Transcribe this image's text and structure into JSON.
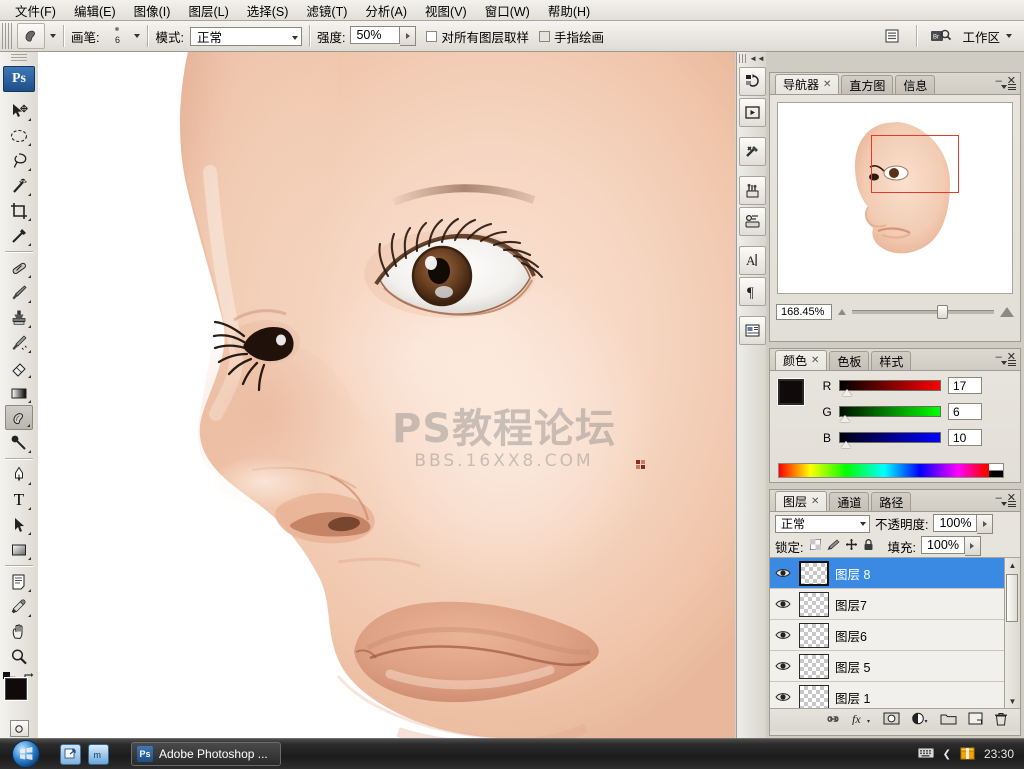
{
  "menubar": {
    "items": [
      {
        "label": "文件(F)"
      },
      {
        "label": "编辑(E)"
      },
      {
        "label": "图像(I)"
      },
      {
        "label": "图层(L)"
      },
      {
        "label": "选择(S)"
      },
      {
        "label": "滤镜(T)"
      },
      {
        "label": "分析(A)"
      },
      {
        "label": "视图(V)"
      },
      {
        "label": "窗口(W)"
      },
      {
        "label": "帮助(H)"
      }
    ]
  },
  "options_bar": {
    "tool_icon": "smudge-tool-icon",
    "brush_label": "画笔:",
    "brush_size": "6",
    "mode_label": "模式:",
    "mode_value": "正常",
    "strength_label": "强度:",
    "strength_value": "50%",
    "sample_all_layers": "对所有图层取样",
    "finger_painting": "手指绘画",
    "palette_toggle": "palette-toggle-icon",
    "bridge_icon": "bridge-icon",
    "workspace_label": "工作区"
  },
  "toolbox": {
    "logo": "Ps",
    "tools": [
      {
        "name": "move-tool",
        "glyph": "move"
      },
      {
        "name": "marquee-tool",
        "glyph": "ellipse"
      },
      {
        "name": "lasso-tool",
        "glyph": "lasso"
      },
      {
        "name": "magic-wand-tool",
        "glyph": "wand"
      },
      {
        "name": "crop-tool",
        "glyph": "crop"
      },
      {
        "name": "slice-tool",
        "glyph": "slice"
      },
      {
        "name": "healing-brush-tool",
        "glyph": "bandage"
      },
      {
        "name": "brush-tool",
        "glyph": "brush"
      },
      {
        "name": "clone-stamp-tool",
        "glyph": "stamp"
      },
      {
        "name": "history-brush-tool",
        "glyph": "historybrush"
      },
      {
        "name": "eraser-tool",
        "glyph": "eraser"
      },
      {
        "name": "gradient-tool",
        "glyph": "gradient"
      },
      {
        "name": "smudge-tool",
        "glyph": "smudge",
        "selected": true
      },
      {
        "name": "dodge-tool",
        "glyph": "dodge"
      },
      {
        "name": "pen-tool",
        "glyph": "pen"
      },
      {
        "name": "type-tool",
        "glyph": "T"
      },
      {
        "name": "path-selection-tool",
        "glyph": "arrow"
      },
      {
        "name": "shape-tool",
        "glyph": "rect"
      },
      {
        "name": "notes-tool",
        "glyph": "note"
      },
      {
        "name": "eyedropper-tool",
        "glyph": "dropper"
      },
      {
        "name": "hand-tool",
        "glyph": "hand"
      },
      {
        "name": "zoom-tool",
        "glyph": "magnifier"
      }
    ],
    "foreground_color": "#110a0a",
    "background_color": "#e8b79a",
    "default_colors_label": "default-colors",
    "swap_colors_label": "swap-colors"
  },
  "canvas": {
    "watermark_line1": "PS教程论坛",
    "watermark_line2": "BBS.16XX8.COM",
    "artwork": "digital-painted-face"
  },
  "icon_dock": {
    "items": [
      {
        "name": "history-panel-icon"
      },
      {
        "name": "actions-panel-icon"
      },
      {
        "name": "tool-presets-icon"
      },
      {
        "name": "brushes-panel-icon"
      },
      {
        "name": "clone-source-icon"
      },
      {
        "name": "character-panel-icon"
      },
      {
        "name": "paragraph-panel-icon"
      },
      {
        "name": "layer-comps-icon"
      }
    ]
  },
  "navigator_panel": {
    "tabs": [
      {
        "label": "导航器",
        "active": true,
        "closable": true
      },
      {
        "label": "直方图",
        "active": false
      },
      {
        "label": "信息",
        "active": false
      }
    ],
    "zoom_value": "168.45%"
  },
  "color_panel": {
    "tabs": [
      {
        "label": "颜色",
        "active": true,
        "closable": true
      },
      {
        "label": "色板",
        "active": false
      },
      {
        "label": "样式",
        "active": false
      }
    ],
    "channels": [
      {
        "label": "R",
        "value": "17",
        "pct": 6.7
      },
      {
        "label": "G",
        "value": "6",
        "pct": 2.4
      },
      {
        "label": "B",
        "value": "10",
        "pct": 3.9
      }
    ],
    "foreground_color": "#110a0a",
    "background_color": "#e8b79a"
  },
  "layers_panel": {
    "tabs": [
      {
        "label": "图层",
        "active": true,
        "closable": true
      },
      {
        "label": "通道",
        "active": false
      },
      {
        "label": "路径",
        "active": false
      }
    ],
    "blend_mode": "正常",
    "opacity_label": "不透明度:",
    "opacity_value": "100%",
    "lock_label": "锁定:",
    "fill_label": "填充:",
    "fill_value": "100%",
    "lock_icons": [
      "lock-transparency-icon",
      "lock-pixels-icon",
      "lock-position-icon",
      "lock-all-icon"
    ],
    "layers": [
      {
        "name": "图层 8",
        "visible": true,
        "selected": true
      },
      {
        "name": "图层7",
        "visible": true,
        "selected": false
      },
      {
        "name": "图层6",
        "visible": true,
        "selected": false
      },
      {
        "name": "图层 5",
        "visible": true,
        "selected": false
      },
      {
        "name": "图层 1",
        "visible": true,
        "selected": false
      }
    ],
    "bottom_buttons": [
      {
        "name": "link-layers-icon"
      },
      {
        "name": "layer-style-fx-icon"
      },
      {
        "name": "add-layer-mask-icon"
      },
      {
        "name": "adjustment-layer-icon"
      },
      {
        "name": "new-group-icon"
      },
      {
        "name": "new-layer-icon"
      },
      {
        "name": "delete-layer-icon"
      }
    ]
  },
  "taskbar": {
    "start_button": "start-orb",
    "quick_launch": [
      {
        "name": "show-desktop-icon"
      },
      {
        "name": "maxthon-browser-icon"
      }
    ],
    "task_button": "Adobe Photoshop ...",
    "task_button_icon": "Ps",
    "tray_icons": [
      "keyboard-language-icon",
      "show-hidden-icons-chevron",
      "update-notify-icon"
    ],
    "clock": "23:30"
  }
}
